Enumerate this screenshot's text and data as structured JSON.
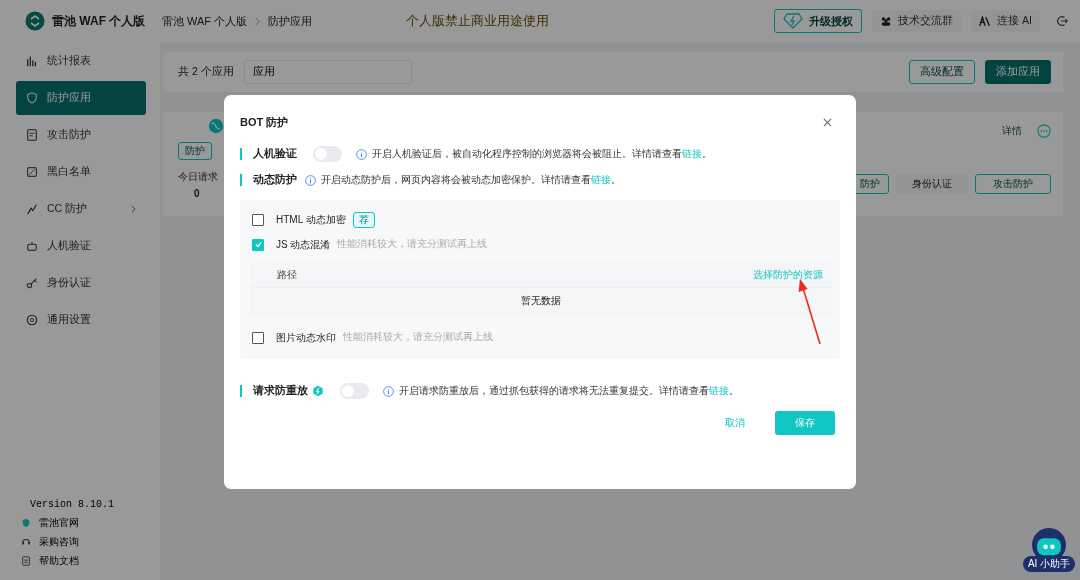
{
  "app": {
    "name": "雷池 WAF 个人版"
  },
  "breadcrumb": [
    "雷池 WAF 个人版",
    "防护应用"
  ],
  "notice": "个人版禁止商业用途使用",
  "header_actions": [
    {
      "kind": "upgrade",
      "label": "升级授权"
    },
    {
      "kind": "group",
      "label": "技术交流群"
    },
    {
      "kind": "ai",
      "label": "连接 AI"
    },
    {
      "kind": "logout"
    }
  ],
  "sidebar": {
    "items": [
      {
        "label": "统计报表",
        "selected": false
      },
      {
        "label": "防护应用",
        "selected": true
      },
      {
        "label": "攻击防护",
        "selected": false
      },
      {
        "label": "黑白名单",
        "selected": false
      },
      {
        "label": "CC 防护",
        "selected": false,
        "expanded": false
      },
      {
        "label": "人机验证",
        "selected": false
      },
      {
        "label": "身份认证",
        "selected": false
      },
      {
        "label": "通用设置",
        "selected": false
      }
    ],
    "version": "Version 8.10.1",
    "links": [
      "雷池官网",
      "采购咨询",
      "帮助文档"
    ]
  },
  "toolbar": {
    "count": "共 2 个应用",
    "search": {
      "value": "应用"
    },
    "buttons": [
      {
        "kind": "outline",
        "label": "高级配置"
      },
      {
        "kind": "primary",
        "label": "添加应用"
      }
    ]
  },
  "app_card": {
    "status": "防护",
    "stat_label": "今日请求",
    "stat_value": "0",
    "detail_link": "详情",
    "tags": [
      {
        "kind": "outline",
        "label": "防护"
      },
      {
        "kind": "plain",
        "label": "身份认证"
      },
      {
        "kind": "outline",
        "label": "攻击防护"
      }
    ]
  },
  "dialog": {
    "title": "BOT 防护",
    "sections": [
      {
        "kind": "toggle",
        "label": "人机验证",
        "pro": false,
        "on": false,
        "info": "开启人机验证后，被自动化程序控制的浏览器将会被阻止。详情请查看",
        "link": "链接",
        "suffix": "。"
      },
      {
        "kind": "options",
        "label": "动态防护",
        "info": "开启动态防护后，网页内容将会被动态加密保护。详情请查看",
        "link": "链接",
        "suffix": "。",
        "options": [
          {
            "label": "HTML 动态加密",
            "checked": false,
            "tag": "荐"
          },
          {
            "label": "JS 动态混淆",
            "checked": true,
            "hint": "性能消耗较大，请充分测试再上线",
            "table": {
              "column": "路径",
              "action": "选择防护的资源",
              "empty": "暂无数据"
            }
          },
          {
            "label": "图片动态水印",
            "checked": false,
            "hint": "性能消耗较大，请充分测试再上线"
          }
        ]
      },
      {
        "kind": "toggle",
        "label": "请求防重放",
        "pro": true,
        "on": false,
        "info": "开启请求防重放后，通过抓包获得的请求将无法重复提交。详情请查看",
        "link": "链接",
        "suffix": "。"
      }
    ],
    "cancel": "取消",
    "save": "保存"
  },
  "assistant": {
    "label": "AI 小助手"
  }
}
